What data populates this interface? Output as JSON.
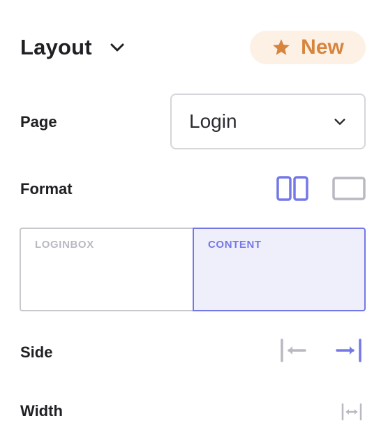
{
  "header": {
    "title": "Layout",
    "badge_label": "New"
  },
  "page_row": {
    "label": "Page",
    "selected": "Login"
  },
  "format_row": {
    "label": "Format",
    "options": [
      "split-layout-icon",
      "single-layout-icon"
    ],
    "selected": "split-layout-icon"
  },
  "preview": {
    "left_pane": "LOGINBOX",
    "right_pane": "CONTENT"
  },
  "side_row": {
    "label": "Side",
    "options": [
      "align-left-icon",
      "align-right-icon"
    ],
    "selected": "align-right-icon"
  },
  "width_row": {
    "label": "Width",
    "icon": "width-expand-icon"
  },
  "colors": {
    "accent": "#7478e6",
    "badge_bg": "#fdf1e6",
    "badge_fg": "#d7843d",
    "inactive_icon": "#b9b9c2"
  }
}
